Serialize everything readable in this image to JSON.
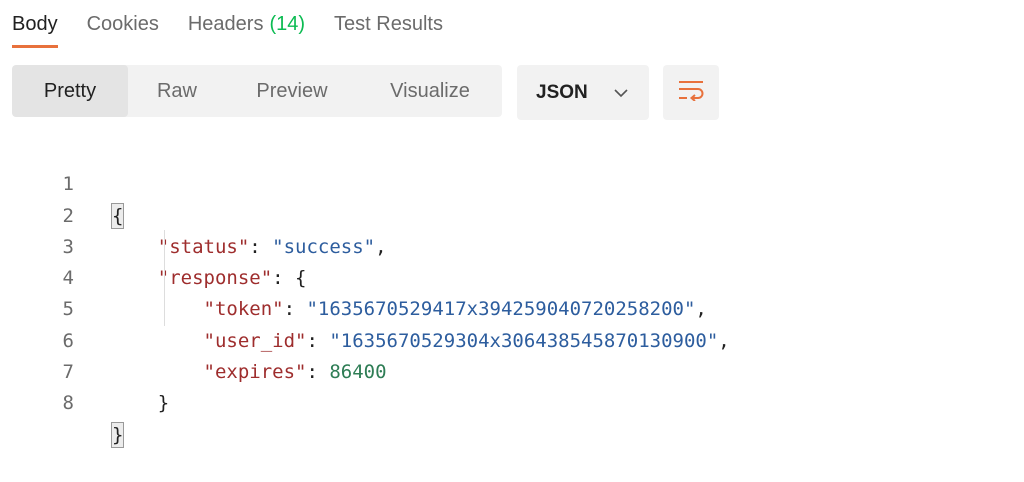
{
  "tabs": [
    {
      "label": "Body",
      "count": ""
    },
    {
      "label": "Cookies",
      "count": ""
    },
    {
      "label": "Headers",
      "count": "(14)"
    },
    {
      "label": "Test Results",
      "count": ""
    }
  ],
  "view_modes": [
    "Pretty",
    "Raw",
    "Preview",
    "Visualize"
  ],
  "format_select": {
    "value": "JSON"
  },
  "icons": {
    "dropdown": "chevron-down-icon",
    "wrap": "wrap-lines-icon"
  },
  "colors": {
    "accent": "#e8713c",
    "count": "#0cbb52",
    "key": "#9e2d2d",
    "string": "#2d5d9e",
    "number": "#2e7d55"
  },
  "code": {
    "line_numbers": [
      "1",
      "2",
      "3",
      "4",
      "5",
      "6",
      "7",
      "8"
    ],
    "open_brace": "{",
    "close_brace": "}",
    "status_key": "\"status\"",
    "status_value": "\"success\"",
    "response_key": "\"response\"",
    "token_key": "\"token\"",
    "token_value": "\"1635670529417x394259040720258200\"",
    "user_id_key": "\"user_id\"",
    "user_id_value": "\"1635670529304x306438545870130900\"",
    "expires_key": "\"expires\"",
    "expires_value": "86400"
  }
}
